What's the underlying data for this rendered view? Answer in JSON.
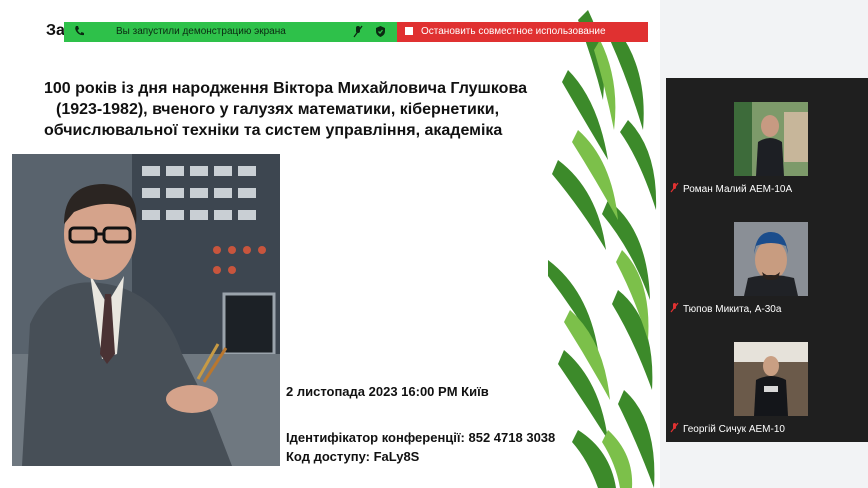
{
  "slide": {
    "title_fragment": "За",
    "headline_lines": [
      "100 років із дня народження Віктора Михайловича Глушкова",
      "(1923-1982), вченого у галузях математики, кібернетики,",
      "обчислювальної техніки та систем управління, академіка"
    ],
    "date_line": "2 листопада 2023 16:00 PM Київ",
    "conference_id_line": "Ідентифікатор конференції: 852 4718 3038",
    "access_code_line": "Код доступу:  FaLy8S"
  },
  "share_bar": {
    "status_text": "Вы запустили демонстрацию экрана",
    "stop_label": "Остановить совместное использование",
    "colors": {
      "green": "#2ec14a",
      "red": "#e03131"
    }
  },
  "participants": [
    {
      "name": "Роман Малий АЕМ-10А",
      "mic": "mic-muted-icon"
    },
    {
      "name": "Тюпов Микита, А-30а",
      "mic": "mic-muted-icon"
    },
    {
      "name": "Георгій Сичук АЕМ-10",
      "mic": "mic-muted-icon"
    }
  ]
}
